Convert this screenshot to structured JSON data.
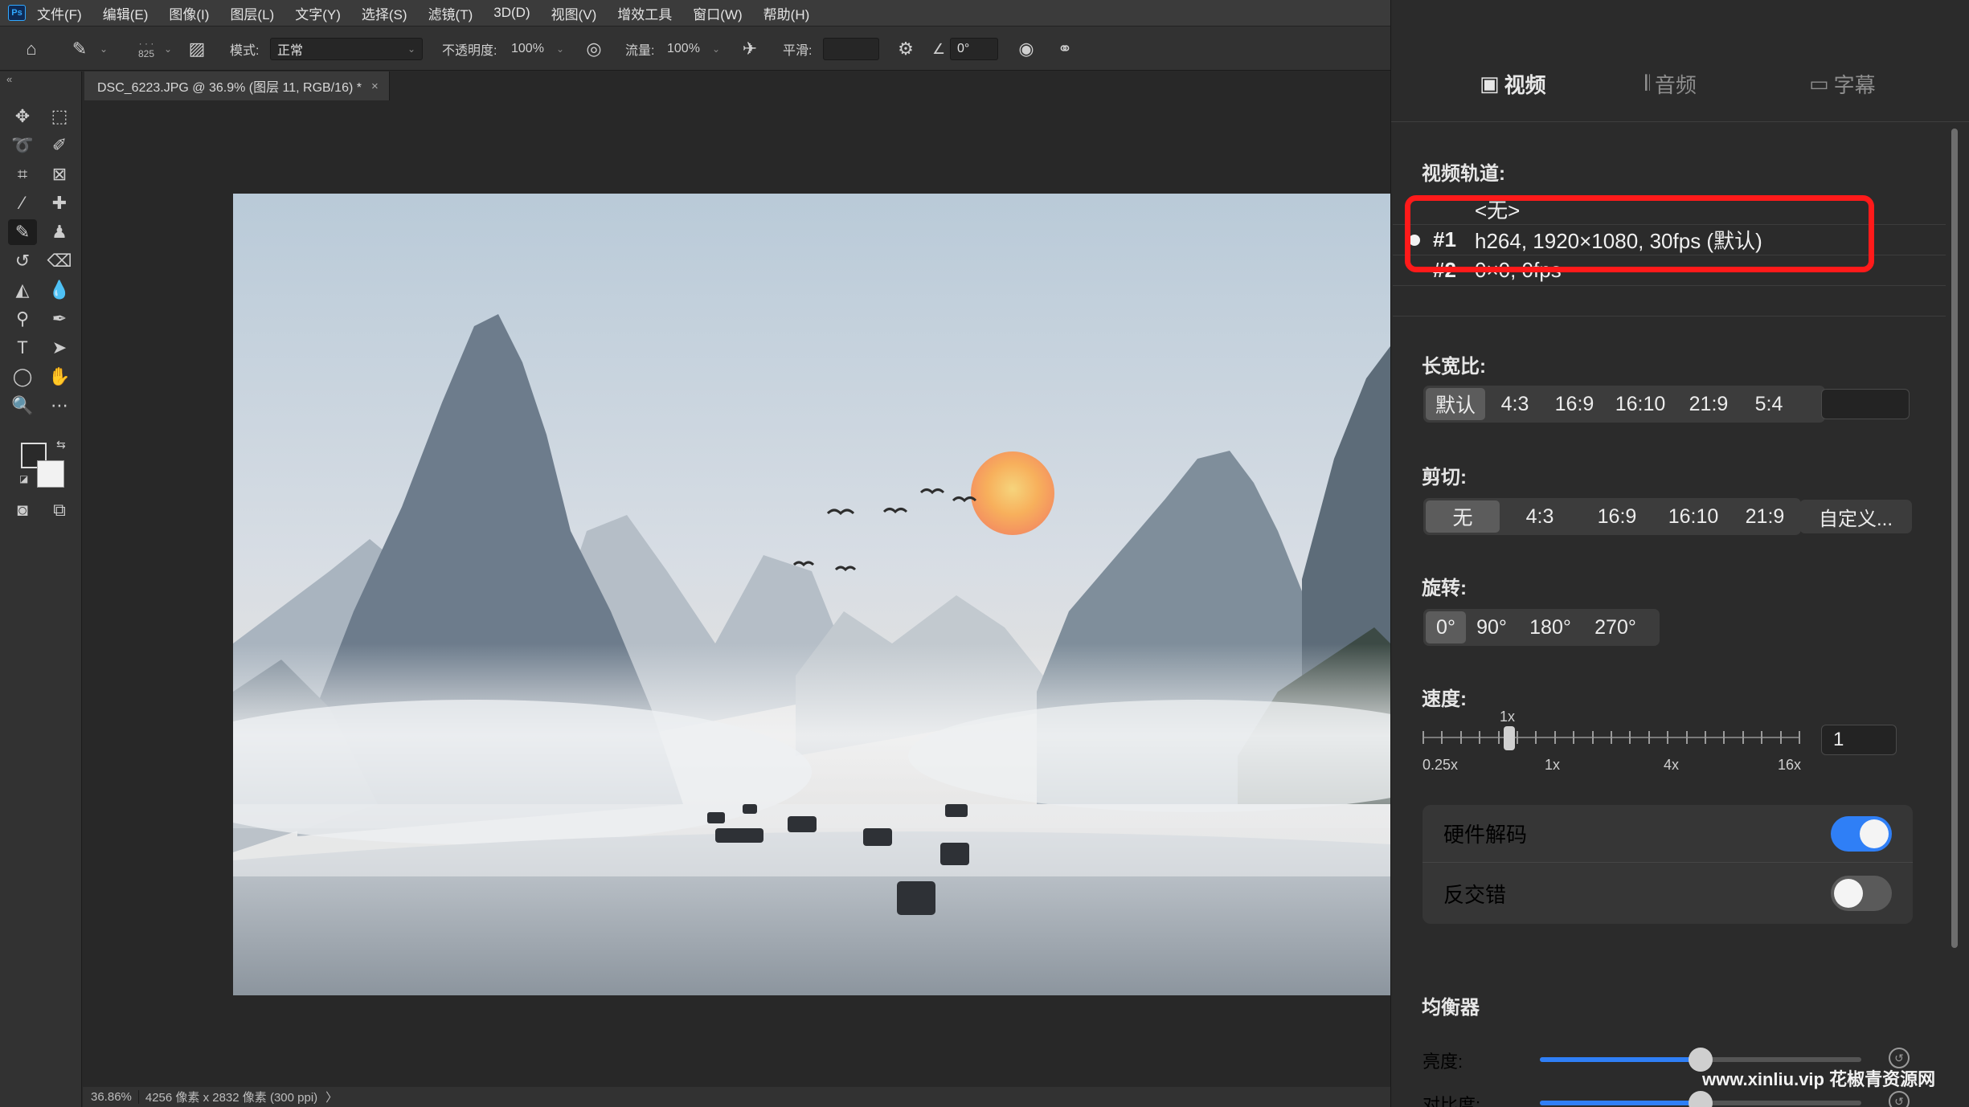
{
  "menubar": {
    "items": [
      "文件(F)",
      "编辑(E)",
      "图像(I)",
      "图层(L)",
      "文字(Y)",
      "选择(S)",
      "滤镜(T)",
      "3D(D)",
      "视图(V)",
      "增效工具",
      "窗口(W)",
      "帮助(H)"
    ]
  },
  "options": {
    "brush_size": "825",
    "mode_label": "模式:",
    "mode_value": "正常",
    "opacity_label": "不透明度:",
    "opacity_value": "100%",
    "flow_label": "流量:",
    "flow_value": "100%",
    "smoothing_label": "平滑:",
    "angle_value": "0°"
  },
  "document": {
    "tab_title": "DSC_6223.JPG @ 36.9% (图层 11, RGB/16) *",
    "tab_close": "×"
  },
  "status": {
    "zoom": "36.86%",
    "info": "4256 像素 x 2832 像素 (300 ppi)",
    "arrow": "〉"
  },
  "panel": {
    "tabs": [
      {
        "icon": "video-icon",
        "label": "视频",
        "active": true
      },
      {
        "icon": "audio-icon",
        "label": "音频",
        "active": false
      },
      {
        "icon": "subtitle-icon",
        "label": "字幕",
        "active": false
      }
    ],
    "video_track": {
      "label": "视频轨道:",
      "tracks": [
        {
          "num": "",
          "text": "<无>"
        },
        {
          "num": "#1",
          "text": "h264, 1920×1080, 30fps (默认)",
          "selected": true
        },
        {
          "num": "#2",
          "text": "0×0, 0fps"
        }
      ]
    },
    "aspect": {
      "label": "长宽比:",
      "options": [
        "默认",
        "4:3",
        "16:9",
        "16:10",
        "21:9",
        "5:4"
      ],
      "selected": "默认",
      "custom_value": ""
    },
    "crop": {
      "label": "剪切:",
      "options": [
        "无",
        "4:3",
        "16:9",
        "16:10",
        "21:9"
      ],
      "selected": "无",
      "custom_button": "自定义..."
    },
    "rotation": {
      "label": "旋转:",
      "options": [
        "0°",
        "90°",
        "180°",
        "270°"
      ],
      "selected": "0°"
    },
    "speed": {
      "label": "速度:",
      "current_label": "1x",
      "tick_labels": [
        "0.25x",
        "1x",
        "4x",
        "16x"
      ],
      "value": "1",
      "level": 0.23
    },
    "hardware_decode": {
      "label": "硬件解码",
      "on": true
    },
    "deinterlace": {
      "label": "反交错",
      "on": false
    },
    "equalizer": {
      "label": "均衡器",
      "rows": [
        {
          "label": "亮度:",
          "level": 0.5
        },
        {
          "label": "对比度:",
          "level": 0.5
        }
      ]
    },
    "watermark": "www.xinliu.vip 花椒青资源网"
  },
  "colors": {
    "accent_blue": "#2f7ff6",
    "highlight_red": "#ff1a1a",
    "panel_bg": "#2b2b2b"
  }
}
